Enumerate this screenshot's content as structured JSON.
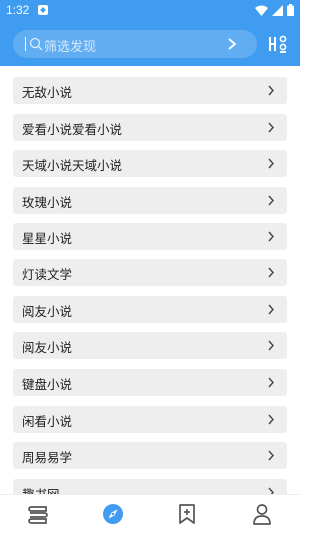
{
  "status_bar": {
    "time": "1:32"
  },
  "search": {
    "placeholder": "筛选发现"
  },
  "sources": [
    {
      "name": "无敌小说"
    },
    {
      "name": "爱看小说爱看小说"
    },
    {
      "name": "天域小说天域小说"
    },
    {
      "name": "玫瑰小说"
    },
    {
      "name": "星星小说"
    },
    {
      "name": "灯读文学"
    },
    {
      "name": "阅友小说"
    },
    {
      "name": "阅友小说"
    },
    {
      "name": "键盘小说"
    },
    {
      "name": "闲看小说"
    },
    {
      "name": "周易易学"
    },
    {
      "name": "趣书网"
    }
  ],
  "bottom_nav": [
    {
      "icon": "bookshelf-icon"
    },
    {
      "icon": "compass-icon",
      "active": true
    },
    {
      "icon": "bookmark-add-icon"
    },
    {
      "icon": "profile-icon"
    }
  ],
  "colors": {
    "accent": "#3f9cf0",
    "item_bg": "#eeeeee",
    "icon_gray": "#555555"
  }
}
